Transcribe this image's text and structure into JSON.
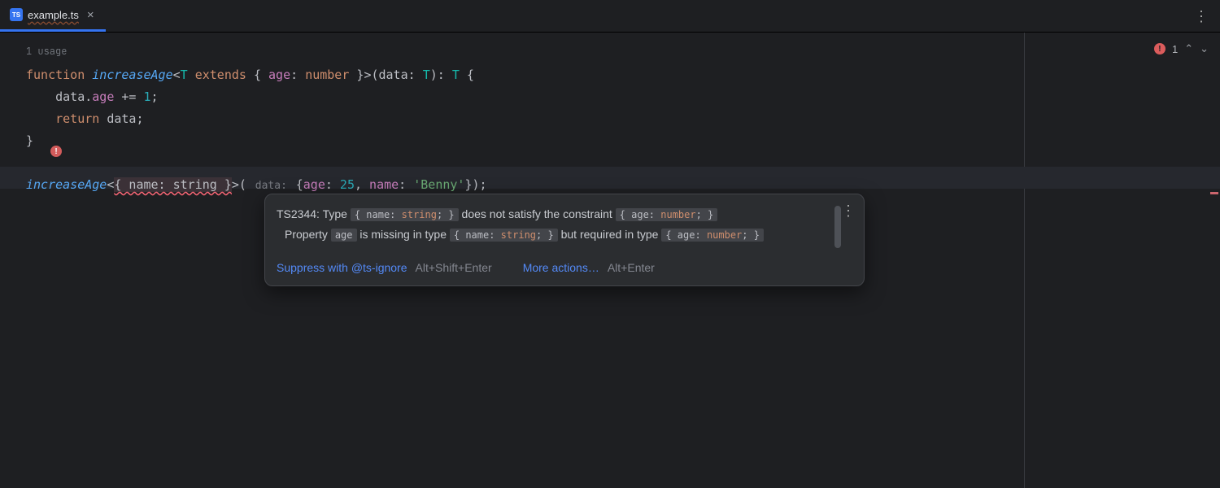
{
  "tab": {
    "icon_label": "TS",
    "filename": "example.ts",
    "close_glyph": "×"
  },
  "topbar_more_glyph": "⋮",
  "right_rail": {
    "err_glyph": "!",
    "count": "1",
    "up": "⌃",
    "down": "⌄"
  },
  "hints": {
    "usage": "1 usage"
  },
  "bulb_glyph": "!",
  "code": {
    "l1": {
      "function": "function",
      "ident": "increaseAge",
      "lt": "<",
      "T": "T",
      "extends": "extends",
      "brace_open": "{ ",
      "prop": "age",
      "colon": ": ",
      "numtype": "number",
      "brace_close": " }",
      "gt": ">",
      "paren_open": "(",
      "param": "data",
      "colon2": ": ",
      "T2": "T",
      "paren_close": ")",
      "colon3": ": ",
      "T3": "T",
      "brace_fn": " {"
    },
    "l2": {
      "indent": "    ",
      "obj": "data",
      "dot": ".",
      "prop": "age",
      "op": " += ",
      "num": "1",
      "semi": ";"
    },
    "l3": {
      "indent": "    ",
      "return": "return",
      "sp": " ",
      "obj": "data",
      "semi": ";"
    },
    "l4": {
      "brace": "}"
    },
    "l6": {
      "call": "increaseAge",
      "lt": "<",
      "err": "{ name: string }",
      "gt": ">",
      "paren_open": "(",
      "hint": " data: ",
      "brace_open": "{",
      "prop1": "age",
      "colon1": ": ",
      "val1": "25",
      "comma": ", ",
      "prop2": "name",
      "colon2": ": ",
      "val2": "'Benny'",
      "brace_close": "}",
      "paren_close": ")",
      "semi": ";"
    }
  },
  "tooltip": {
    "head_code": "TS2344",
    "head_pre": ": Type ",
    "chip1_pre": "{ name: ",
    "chip1_type": "string",
    "chip1_post": "; }",
    "head_mid": " does not satisfy the constraint ",
    "chip2_pre": "{ age: ",
    "chip2_type": "number",
    "chip2_post": "; }",
    "sub_pre": "Property ",
    "chip3": "age",
    "sub_mid1": " is missing in type ",
    "chip4_pre": "{ name: ",
    "chip4_type": "string",
    "chip4_post": "; }",
    "sub_mid2": " but required in type ",
    "chip5_pre": "{ age: ",
    "chip5_type": "number",
    "chip5_post": "; }",
    "more_glyph": "⋮",
    "action1": "Suppress with @ts-ignore",
    "shortcut1": "Alt+Shift+Enter",
    "action2": "More actions…",
    "shortcut2": "Alt+Enter"
  }
}
